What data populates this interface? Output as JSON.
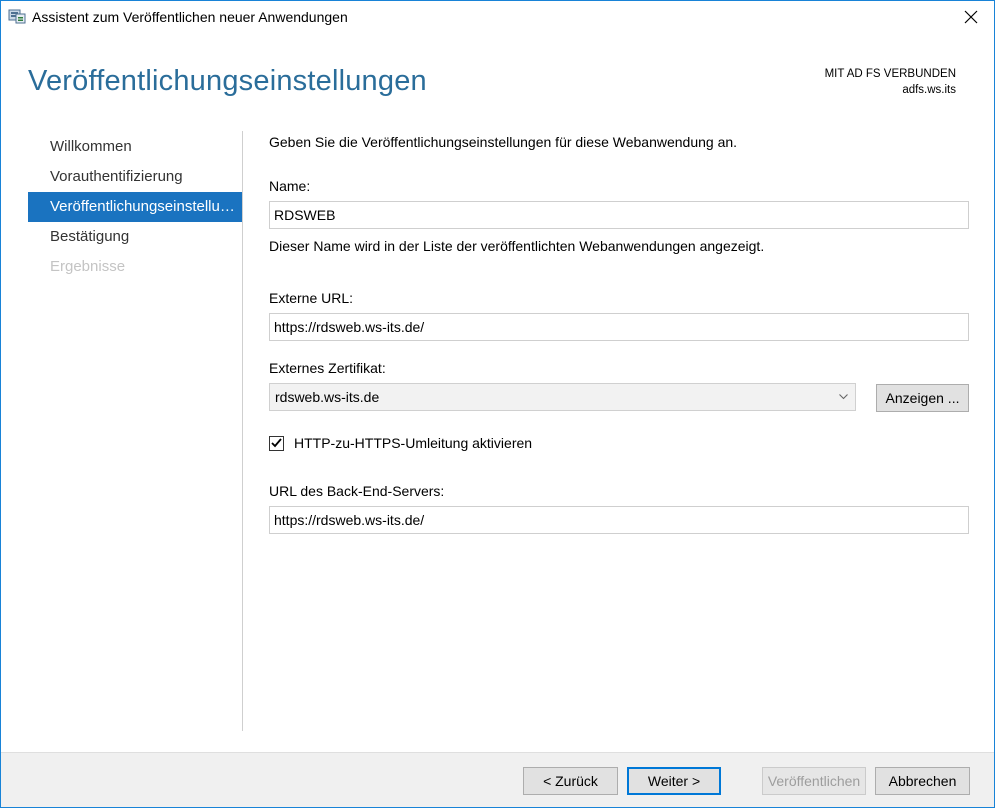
{
  "window": {
    "title": "Assistent zum Veröffentlichen neuer Anwendungen"
  },
  "header": {
    "title": "Veröffentlichungseinstellungen",
    "status_line1": "MIT AD FS VERBUNDEN",
    "status_line2": "adfs.ws.its"
  },
  "sidebar": {
    "items": [
      {
        "label": "Willkommen",
        "state": "normal"
      },
      {
        "label": "Vorauthentifizierung",
        "state": "normal"
      },
      {
        "label": "Veröffentlichungseinstellungen",
        "state": "active"
      },
      {
        "label": "Bestätigung",
        "state": "normal"
      },
      {
        "label": "Ergebnisse",
        "state": "disabled"
      }
    ]
  },
  "form": {
    "intro": "Geben Sie die Veröffentlichungseinstellungen für diese Webanwendung an.",
    "name_label": "Name:",
    "name_value": "RDSWEB",
    "name_hint": "Dieser Name wird in der Liste der veröffentlichten Webanwendungen angezeigt.",
    "external_url_label": "Externe URL:",
    "external_url_value": "https://rdsweb.ws-its.de/",
    "certificate_label": "Externes Zertifikat:",
    "certificate_value": "rdsweb.ws-its.de",
    "show_button": "Anzeigen ...",
    "redirect_label": "HTTP-zu-HTTPS-Umleitung aktivieren",
    "redirect_checked": true,
    "backend_label": "URL des Back-End-Servers:",
    "backend_value": "https://rdsweb.ws-its.de/"
  },
  "footer": {
    "back": "< Zurück",
    "next": "Weiter >",
    "publish": "Veröffentlichen",
    "cancel": "Abbrechen"
  },
  "colors": {
    "accent": "#1a73c0",
    "title": "#2a6d9a",
    "window_border": "#1883d7"
  }
}
